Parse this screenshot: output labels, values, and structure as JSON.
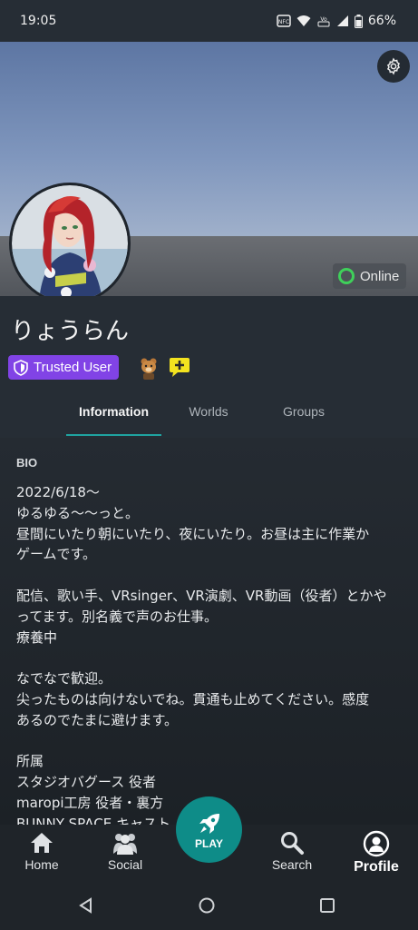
{
  "status_bar": {
    "time": "19:05",
    "battery": "66%",
    "icons": [
      "nfc-icon",
      "wifi-icon",
      "volte-icon",
      "signal-icon",
      "battery-icon"
    ]
  },
  "profile": {
    "username": "りょうらん",
    "status": "Online",
    "trust_badge": "Trusted User",
    "colors": {
      "trusted": "#8143e6",
      "online": "#3fd05a",
      "accent": "#1fa3a0"
    }
  },
  "tabs": [
    {
      "label": "Information",
      "active": true
    },
    {
      "label": "Worlds",
      "active": false
    },
    {
      "label": "Groups",
      "active": false
    }
  ],
  "bio": {
    "label": "BIO",
    "text": "2022/6/18〜\nゆるゆる〜〜っと。\n昼間にいたり朝にいたり、夜にいたり。お昼は主に作業か\nゲームです。\n\n配信、歌い手、VRsinger、VR演劇、VR動画（役者）とかや\nってます。別名義で声のお仕事。\n療養中\n\nなでなで歓迎。\n尖ったものは向けないでね。貫通も止めてください。感度\nあるのでたまに避けます。\n\n所属\nスタジオバグース 役者\nmaropi工房 役者・裏方\nBUNNY SPACE キャスト"
  },
  "bottom_nav": {
    "home": "Home",
    "social": "Social",
    "play": "PLAY",
    "search": "Search",
    "profile": "Profile"
  }
}
